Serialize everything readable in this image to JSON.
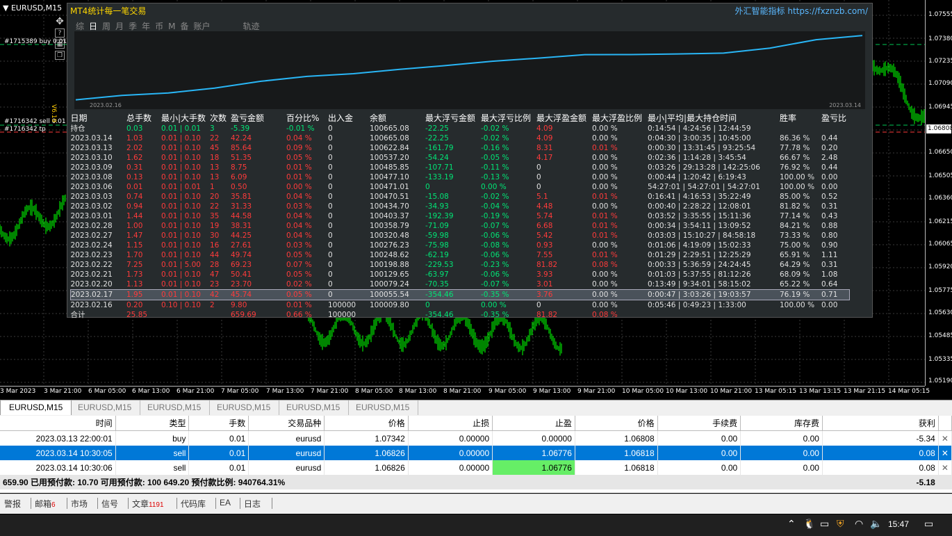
{
  "chart": {
    "symbol_title": "EURUSD,M15",
    "current_price": "1.06808",
    "price_ticks": [
      "1.07555",
      "1.07380",
      "1.07235",
      "1.07090",
      "1.06945",
      "1.06650",
      "1.06505",
      "1.06360",
      "1.06215",
      "1.06065",
      "1.05920",
      "1.05775",
      "1.05630",
      "1.05485",
      "1.05335",
      "1.05190"
    ],
    "time_ticks": [
      "3 Mar 2023",
      "3 Mar 21:00",
      "6 Mar 05:00",
      "6 Mar 13:00",
      "6 Mar 21:00",
      "7 Mar 05:00",
      "7 Mar 13:00",
      "7 Mar 21:00",
      "8 Mar 05:00",
      "8 Mar 13:00",
      "8 Mar 21:00",
      "9 Mar 05:00",
      "9 Mar 13:00",
      "9 Mar 21:00",
      "10 Mar 05:00",
      "10 Mar 13:00",
      "10 Mar 21:00",
      "13 Mar 05:15",
      "13 Mar 13:15",
      "13 Mar 21:15",
      "14 Mar 05:15"
    ],
    "order_labels": [
      "#1715389 buy 0.01",
      "#1716342 sell 0.01",
      "#1716342 tp"
    ],
    "vertical_label": "V6.19",
    "tool_icons": [
      "move-icon",
      "help-icon",
      "grid-icon",
      "window-icon"
    ]
  },
  "panel": {
    "title": "MT4统计每一笔交易",
    "site": "外汇智能指标 https://fxznzb.com/",
    "tabs": [
      "综",
      "日",
      "周",
      "月",
      "季",
      "年",
      "币",
      "M",
      "备",
      "账户"
    ],
    "active_tab": "日",
    "extra_tab": "轨迹",
    "curve_start": "2023.02.16",
    "curve_end": "2023.03.14",
    "headers": [
      "日期",
      "总手数",
      "最小|大手数",
      "次数",
      "盈亏金额",
      "百分比%",
      "出入金",
      "余额",
      "最大浮亏金额",
      "最大浮亏比例",
      "最大浮盈金额",
      "最大浮盈比例",
      "最小|平均|最大持仓时间",
      "胜率",
      "盈亏比"
    ],
    "rows": [
      {
        "cells": [
          "持仓",
          "0.03",
          "0.01 | 0.01",
          "3",
          "-5.39",
          "-0.01 %",
          "0",
          "100665.08",
          "-22.25",
          "-0.02 %",
          "4.09",
          "0.00 %",
          "0:14:54 | 4:24:56 | 12:44:59",
          "",
          ""
        ],
        "tone": "g"
      },
      {
        "cells": [
          "2023.03.14",
          "1.03",
          "0.01 | 0.10",
          "22",
          "42.24",
          "0.04 %",
          "0",
          "100665.08",
          "-22.25",
          "-0.02 %",
          "4.09",
          "0.00 %",
          "0:04:30 | 3:00:35 | 10:45:00",
          "86.36 %",
          "0.44"
        ],
        "tone": "r"
      },
      {
        "cells": [
          "2023.03.13",
          "2.02",
          "0.01 | 0.10",
          "45",
          "85.64",
          "0.09 %",
          "0",
          "100622.84",
          "-161.79",
          "-0.16 %",
          "8.31",
          "0.01 %",
          "0:00:30 | 13:31:45 | 93:25:54",
          "77.78 %",
          "0.20"
        ],
        "tone": "r"
      },
      {
        "cells": [
          "2023.03.10",
          "1.62",
          "0.01 | 0.10",
          "18",
          "51.35",
          "0.05 %",
          "0",
          "100537.20",
          "-54.24",
          "-0.05 %",
          "4.17",
          "0.00 %",
          "0:02:36 | 1:14:28 | 3:45:54",
          "66.67 %",
          "2.48"
        ],
        "tone": "r"
      },
      {
        "cells": [
          "2023.03.09",
          "0.31",
          "0.01 | 0.10",
          "13",
          "8.75",
          "0.01 %",
          "0",
          "100485.85",
          "-107.71",
          "-0.11 %",
          "0",
          "0.00 %",
          "0:03:26 | 29:13:28 | 142:25:06",
          "76.92 %",
          "0.44"
        ],
        "tone": "r"
      },
      {
        "cells": [
          "2023.03.08",
          "0.13",
          "0.01 | 0.10",
          "13",
          "6.09",
          "0.01 %",
          "0",
          "100477.10",
          "-133.19",
          "-0.13 %",
          "0",
          "0.00 %",
          "0:00:44 | 1:20:42 | 6:19:43",
          "100.00 %",
          "0.00"
        ],
        "tone": "r"
      },
      {
        "cells": [
          "2023.03.06",
          "0.01",
          "0.01 | 0.01",
          "1",
          "0.50",
          "0.00 %",
          "0",
          "100471.01",
          "0",
          "0.00 %",
          "0",
          "0.00 %",
          "54:27:01 | 54:27:01 | 54:27:01",
          "100.00 %",
          "0.00"
        ],
        "tone": "r"
      },
      {
        "cells": [
          "2023.03.03",
          "0.74",
          "0.01 | 0.10",
          "20",
          "35.81",
          "0.04 %",
          "0",
          "100470.51",
          "-15.08",
          "-0.02 %",
          "5.1",
          "0.01 %",
          "0:16:41 | 4:16:53 | 35:22:49",
          "85.00 %",
          "0.52"
        ],
        "tone": "r"
      },
      {
        "cells": [
          "2023.03.02",
          "0.94",
          "0.01 | 0.10",
          "22",
          "31.33",
          "0.03 %",
          "0",
          "100434.70",
          "-34.93",
          "-0.04 %",
          "4.48",
          "0.00 %",
          "0:00:40 | 2:28:22 | 12:08:01",
          "81.82 %",
          "0.31"
        ],
        "tone": "r"
      },
      {
        "cells": [
          "2023.03.01",
          "1.44",
          "0.01 | 0.10",
          "35",
          "44.58",
          "0.04 %",
          "0",
          "100403.37",
          "-192.39",
          "-0.19 %",
          "5.74",
          "0.01 %",
          "0:03:52 | 3:35:55 | 15:11:36",
          "77.14 %",
          "0.43"
        ],
        "tone": "r"
      },
      {
        "cells": [
          "2023.02.28",
          "1.00",
          "0.01 | 0.10",
          "19",
          "38.31",
          "0.04 %",
          "0",
          "100358.79",
          "-71.09",
          "-0.07 %",
          "6.68",
          "0.01 %",
          "0:00:34 | 3:54:11 | 13:09:52",
          "84.21 %",
          "0.88"
        ],
        "tone": "r"
      },
      {
        "cells": [
          "2023.02.27",
          "1.47",
          "0.01 | 0.10",
          "30",
          "44.25",
          "0.04 %",
          "0",
          "100320.48",
          "-59.98",
          "-0.06 %",
          "5.42",
          "0.01 %",
          "0:03:03 | 15:10:27 | 84:58:18",
          "73.33 %",
          "0.80"
        ],
        "tone": "r"
      },
      {
        "cells": [
          "2023.02.24",
          "1.15",
          "0.01 | 0.10",
          "16",
          "27.61",
          "0.03 %",
          "0",
          "100276.23",
          "-75.98",
          "-0.08 %",
          "0.93",
          "0.00 %",
          "0:01:06 | 4:19:09 | 15:02:33",
          "75.00 %",
          "0.90"
        ],
        "tone": "r"
      },
      {
        "cells": [
          "2023.02.23",
          "1.70",
          "0.01 | 0.10",
          "44",
          "49.74",
          "0.05 %",
          "0",
          "100248.62",
          "-62.19",
          "-0.06 %",
          "7.55",
          "0.01 %",
          "0:01:29 | 2:29:51 | 12:25:29",
          "65.91 %",
          "1.11"
        ],
        "tone": "r"
      },
      {
        "cells": [
          "2023.02.22",
          "7.25",
          "0.01 | 5.00",
          "28",
          "69.23",
          "0.07 %",
          "0",
          "100198.88",
          "-229.53",
          "-0.23 %",
          "81.82",
          "0.08 %",
          "0:00:33 | 5:36:59 | 24:24:45",
          "64.29 %",
          "0.31"
        ],
        "tone": "r"
      },
      {
        "cells": [
          "2023.02.21",
          "1.73",
          "0.01 | 0.10",
          "47",
          "50.41",
          "0.05 %",
          "0",
          "100129.65",
          "-63.97",
          "-0.06 %",
          "3.93",
          "0.00 %",
          "0:01:03 | 5:37:55 | 81:12:26",
          "68.09 %",
          "1.08"
        ],
        "tone": "r"
      },
      {
        "cells": [
          "2023.02.20",
          "1.13",
          "0.01 | 0.10",
          "23",
          "23.70",
          "0.02 %",
          "0",
          "100079.24",
          "-70.35",
          "-0.07 %",
          "3.01",
          "0.00 %",
          "0:13:49 | 9:34:01 | 58:15:02",
          "65.22 %",
          "0.64"
        ],
        "tone": "r"
      },
      {
        "cells": [
          "2023.02.17",
          "1.95",
          "0.01 | 0.10",
          "42",
          "45.74",
          "0.05 %",
          "0",
          "100055.54",
          "-354.46",
          "-0.35 %",
          "3.76",
          "0.00 %",
          "0:00:47 | 3:03:26 | 19:03:57",
          "76.19 %",
          "0.71"
        ],
        "tone": "r",
        "selected": true
      },
      {
        "cells": [
          "2023.02.16",
          "0.20",
          "0.10 | 0.10",
          "2",
          "9.80",
          "0.01 %",
          "100000",
          "100009.80",
          "0",
          "0.00 %",
          "0",
          "0.00 %",
          "0:05:46 | 0:49:23 | 1:33:00",
          "100.00 %",
          "0.00"
        ],
        "tone": "r"
      },
      {
        "cells": [
          "合计",
          "25.85",
          "",
          "",
          "659.69",
          "0.66 %",
          "100000",
          "",
          "-354.46",
          "-0.35 %",
          "81.82",
          "0.08 %",
          "",
          "",
          ""
        ],
        "tone": "r",
        "total": true
      }
    ]
  },
  "symbol_tabs": [
    "EURUSD,M15",
    "EURUSD,M15",
    "EURUSD,M15",
    "EURUSD,M15",
    "EURUSD,M15",
    "EURUSD,M15"
  ],
  "trades": {
    "headers": [
      "时间",
      "类型",
      "手数",
      "交易品种",
      "价格",
      "止损",
      "止盈",
      "价格",
      "手续费",
      "库存费",
      "获利"
    ],
    "rows": [
      {
        "cells": [
          "2023.03.13 22:00:01",
          "buy",
          "0.01",
          "eurusd",
          "1.07342",
          "0.00000",
          "0.00000",
          "1.06808",
          "0.00",
          "0.00",
          "-5.34"
        ],
        "highlight": false,
        "tp_green": false
      },
      {
        "cells": [
          "2023.03.14 10:30:05",
          "sell",
          "0.01",
          "eurusd",
          "1.06826",
          "0.00000",
          "1.06776",
          "1.06818",
          "0.00",
          "0.00",
          "0.08"
        ],
        "highlight": true,
        "tp_green": true
      },
      {
        "cells": [
          "2023.03.14 10:30:06",
          "sell",
          "0.01",
          "eurusd",
          "1.06826",
          "0.00000",
          "1.06776",
          "1.06818",
          "0.00",
          "0.00",
          "0.08"
        ],
        "highlight": false,
        "tp_green": true
      }
    ],
    "account_line": "659.90  已用预付款: 10.70  可用预付款: 100 649.20  预付款比例: 940764.31%",
    "account_profit": "-5.18"
  },
  "tool_tabs": [
    {
      "label": "警报",
      "count": ""
    },
    {
      "label": "邮箱",
      "count": "6"
    },
    {
      "label": "市场",
      "count": ""
    },
    {
      "label": "信号",
      "count": ""
    },
    {
      "label": "文章",
      "count": "1191"
    },
    {
      "label": "代码库",
      "count": ""
    },
    {
      "label": "EA",
      "count": ""
    },
    {
      "label": "日志",
      "count": ""
    }
  ],
  "taskbar": {
    "time": "15:47"
  },
  "colors": {
    "profit_green": "#00e676",
    "loss_red": "#ff3b3b",
    "curve_blue": "#29b6f6",
    "select_blue": "#0078d7",
    "tp_green": "#66ee66"
  }
}
